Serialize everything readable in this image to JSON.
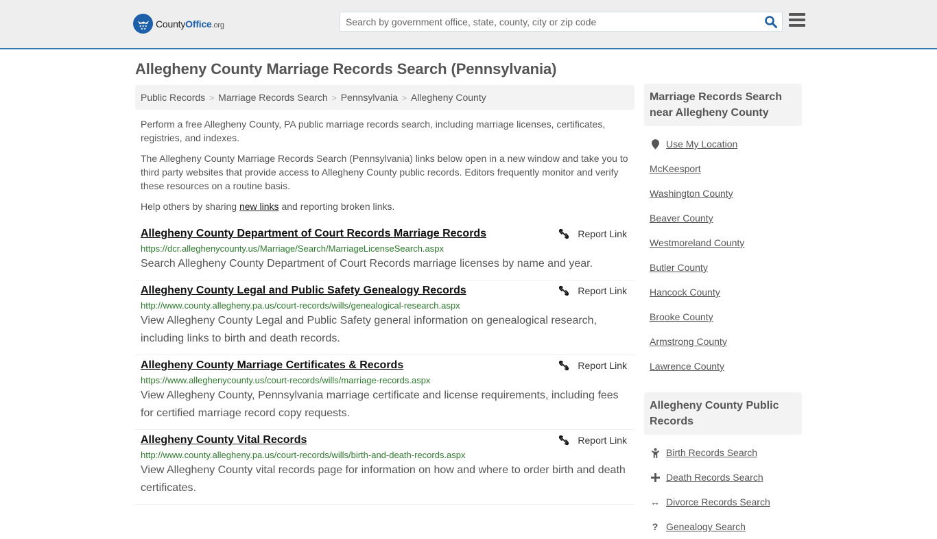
{
  "header": {
    "logo": {
      "name_part1": "County",
      "name_part2": "Office",
      "tld": ".org"
    },
    "search": {
      "placeholder": "Search by government office, state, county, city or zip code",
      "value": ""
    },
    "icons": {
      "search": "search-icon",
      "menu": "hamburger-menu-icon"
    }
  },
  "page": {
    "title": "Allegheny County Marriage Records Search (Pennsylvania)"
  },
  "breadcrumb": [
    {
      "label": "Public Records"
    },
    {
      "label": "Marriage Records Search"
    },
    {
      "label": "Pennsylvania"
    },
    {
      "label": "Allegheny County"
    }
  ],
  "breadcrumb_separator": ">",
  "intro": {
    "p1": "Perform a free Allegheny County, PA public marriage records search, including marriage licenses, certificates, registries, and indexes.",
    "p2": "The Allegheny County Marriage Records Search (Pennsylvania) links below open in a new window and take you to third party websites that provide access to Allegheny County public records. Editors frequently monitor and verify these resources on a routine basis.",
    "p3_before": "Help others by sharing ",
    "p3_link": "new links",
    "p3_after": " and reporting broken links."
  },
  "report_label": "Report Link",
  "results": [
    {
      "title": "Allegheny County Department of Court Records Marriage Records",
      "url": "https://dcr.alleghenycounty.us/Marriage/Search/MarriageLicenseSearch.aspx",
      "description": "Search Allegheny County Department of Court Records marriage licenses by name and year."
    },
    {
      "title": "Allegheny County Legal and Public Safety Genealogy Records",
      "url": "http://www.county.allegheny.pa.us/court-records/wills/genealogical-research.aspx",
      "description": "View Allegheny County Legal and Public Safety general information on genealogical research, including links to birth and death records."
    },
    {
      "title": "Allegheny County Marriage Certificates & Records",
      "url": "https://www.alleghenycounty.us/court-records/wills/marriage-records.aspx",
      "description": "View Allegheny County, Pennsylvania marriage certificate and license requirements, including fees for certified marriage record copy requests."
    },
    {
      "title": "Allegheny County Vital Records",
      "url": "http://www.county.allegheny.pa.us/court-records/wills/birth-and-death-records.aspx",
      "description": "View Allegheny County vital records page for information on how and where to order birth and death certificates."
    }
  ],
  "sidebar": {
    "nearby": {
      "heading": "Marriage Records Search near Allegheny County",
      "use_location": "Use My Location",
      "items": [
        "McKeesport",
        "Washington County",
        "Beaver County",
        "Westmoreland County",
        "Butler County",
        "Hancock County",
        "Brooke County",
        "Armstrong County",
        "Lawrence County"
      ]
    },
    "public_records": {
      "heading": "Allegheny County Public Records",
      "items": [
        {
          "label": "Birth Records Search",
          "icon": "child-icon"
        },
        {
          "label": "Death Records Search",
          "icon": "plus-icon"
        },
        {
          "label": "Divorce Records Search",
          "icon": "arrows-horizontal-icon"
        },
        {
          "label": "Genealogy Search",
          "icon": "question-icon"
        }
      ]
    }
  },
  "colors": {
    "brand_blue": "#1d5fa8",
    "header_border": "#3479b0",
    "url_green": "#2d7b2d",
    "header_bg": "#eeeeee"
  }
}
